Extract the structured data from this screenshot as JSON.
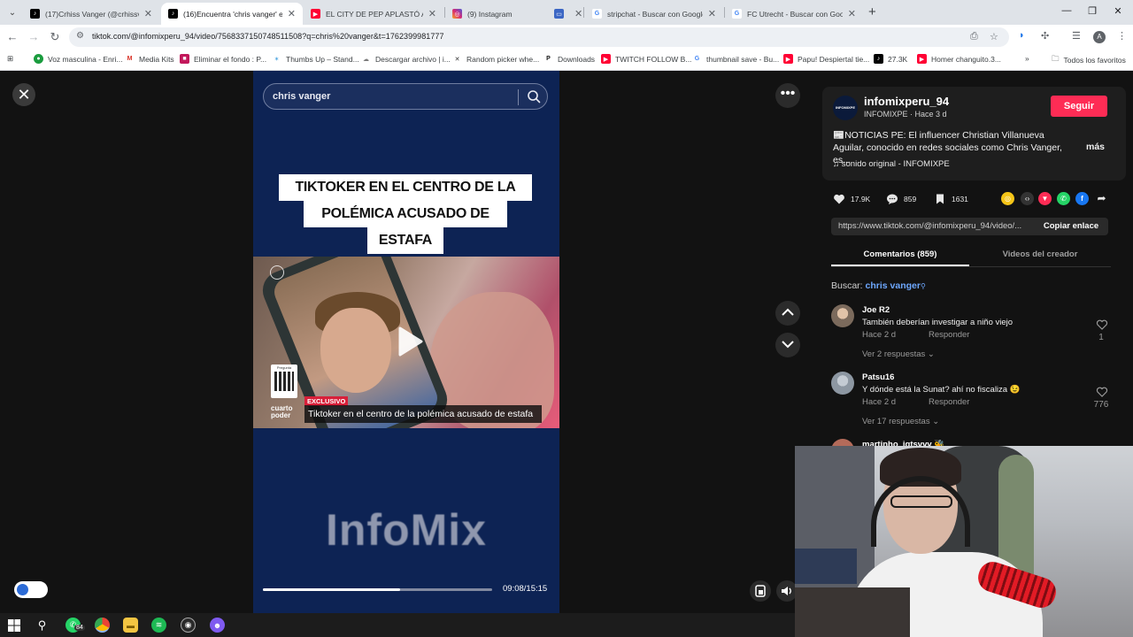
{
  "browser": {
    "tabs": [
      {
        "title": "(17)Crhiss Vanger (@crhissvang",
        "favicon": "tiktok-icon",
        "color": "#000000",
        "active": false
      },
      {
        "title": "(16)Encuentra 'chris vanger' en",
        "favicon": "tiktok-icon",
        "color": "#000000",
        "active": true
      },
      {
        "title": "EL CITY DE PEP APLASTÓ AL D",
        "favicon": "youtube-icon",
        "color": "#ff0033",
        "active": false
      },
      {
        "title": "(9) Instagram",
        "favicon": "instagram-icon",
        "color": "#d62976",
        "active": false
      },
      {
        "title": "",
        "favicon": "window-icon",
        "color": "#3b66c4",
        "active": false
      },
      {
        "title": "stripchat - Buscar con Google",
        "favicon": "google-icon",
        "color": "#4285f4",
        "active": false
      },
      {
        "title": "FC Utrecht - Buscar con Google",
        "favicon": "google-icon",
        "color": "#4285f4",
        "active": false
      }
    ],
    "url": "tiktok.com/@infomixperu_94/video/7568337150748511508?q=chris%20vanger&t=1762399981777",
    "profile_initial": "A",
    "bookmarks": [
      {
        "label": "Voz masculina - Enri...",
        "icon": "green-circle-icon",
        "color": "#1a9c3e"
      },
      {
        "label": "Media Kits",
        "icon": "gmail-icon",
        "color": "#d93025"
      },
      {
        "label": "Eliminar el fondo : P...",
        "icon": "removebg-icon",
        "color": "#c2185b"
      },
      {
        "label": "Thumbs Up – Stand...",
        "icon": "star-icon",
        "color": "#4aa3df"
      },
      {
        "label": "Descargar archivo | i...",
        "icon": "cloud-icon",
        "color": "#7a7a7a"
      },
      {
        "label": "Random picker whe...",
        "icon": "cross-icon",
        "color": "#333333"
      },
      {
        "label": "Downloads",
        "icon": "p-icon",
        "color": "#111111"
      },
      {
        "label": "TWITCH FOLLOW B...",
        "icon": "youtube-icon",
        "color": "#ff0033"
      },
      {
        "label": "thumbnail save - Bu...",
        "icon": "google-icon",
        "color": "#4285f4"
      },
      {
        "label": "Papu! Despiertal tie...",
        "icon": "youtube-icon",
        "color": "#ff0033"
      },
      {
        "label": "27.3K",
        "icon": "tiktok-icon",
        "color": "#000000"
      },
      {
        "label": "Homer changuito.3...",
        "icon": "youtube-icon",
        "color": "#ff0033"
      }
    ],
    "all_bookmarks": "Todos los favoritos"
  },
  "video": {
    "search_query": "chris vanger",
    "headline_lines": [
      "TIKTOKER EN EL CENTRO DE LA",
      "POLÉMICA ACUSADO DE",
      "ESTAFA"
    ],
    "qr_label": "Pregunta",
    "exclusivo": "EXCLUSIVO",
    "lower_third": "Tiktoker en el centro de la polémica acusado de estafa",
    "brand_logo": "cuarto poder",
    "watermark": "InfoMix",
    "time": "09:08/15:15",
    "progress": 0.6
  },
  "panel": {
    "username": "infomixperu_94",
    "avatar_text": "INFOMIXPE",
    "subline": "INFOMIXPE · Hace 3 d",
    "follow": "Seguir",
    "description": "📰NOTICIAS PE: El influencer Christian Villanueva Aguilar, conocido en redes sociales como Chris Vanger, es...",
    "more": "más",
    "sound": "♫  sonido original - INFOMIXPE",
    "likes": "17.9K",
    "comments": "859",
    "saves": "1631",
    "link": "https://www.tiktok.com/@infomixperu_94/video/...",
    "copy": "Copiar enlace",
    "tab_comments": "Comentarios (859)",
    "tab_creator": "Videos del creador",
    "search_prefix": "Buscar: ",
    "search_term": "chris vanger",
    "comment_list": [
      {
        "name": "Joe R2",
        "text": "También deberían investigar a niño viejo",
        "meta": "Hace 2 d",
        "reply": "Responder",
        "more": "Ver 2 respuestas ⌄",
        "likes": "1",
        "avatar_color": "#7b6a5c"
      },
      {
        "name": "Patsu16",
        "text": "Y dónde está la Sunat? ahí no fiscaliza 😉",
        "meta": "Hace 2 d",
        "reply": "Responder",
        "more": "Ver 17 respuestas ⌄",
        "likes": "776",
        "avatar_color": "#9aa3ad"
      },
      {
        "name": "martinho_igtsvvv 🐝",
        "text": "",
        "meta": "",
        "reply": "",
        "more": "",
        "likes": "",
        "avatar_color": "#b46b5a"
      }
    ]
  },
  "taskbar": {
    "badge": "84"
  }
}
